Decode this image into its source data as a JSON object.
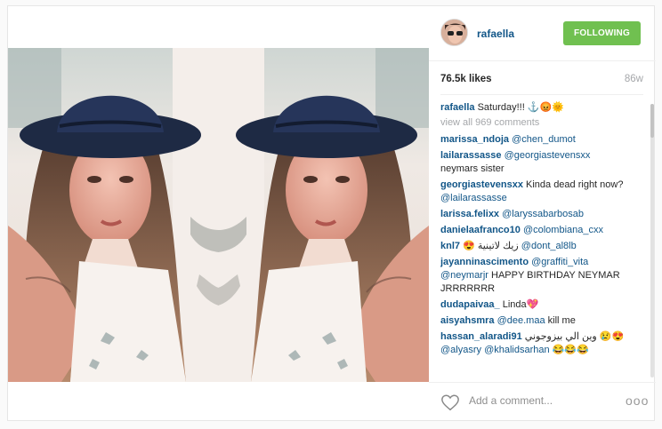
{
  "header": {
    "username": "rafaella",
    "follow_label": "FOLLOWING"
  },
  "stats": {
    "likes": "76.5k likes",
    "age": "86w"
  },
  "caption": {
    "user": "rafaella",
    "text": "Saturday!!! ⚓😡🌞"
  },
  "view_all": "view all 969 comments",
  "comments": [
    {
      "user": "marissa_ndoja",
      "mention": "@chen_dumot",
      "text": ""
    },
    {
      "user": "lailarassasse",
      "mention": "@georgiastevensxx",
      "text": "neymars sister"
    },
    {
      "user": "georgiastevensxx",
      "text": "Kinda dead right now?",
      "mention": "@lailarassasse"
    },
    {
      "user": "larissa.felixx",
      "mention": "@laryssabarbosab",
      "text": ""
    },
    {
      "user": "danielaafranco10",
      "mention": "@colombiana_cxx",
      "text": ""
    },
    {
      "user": "knl7",
      "text": "😍 زيك لاتينية",
      "mention": "@dont_al8lb"
    },
    {
      "user": "jayanninascimento",
      "mention": "@graffiti_vita",
      "mention2": "@neymarjr",
      "text": "HAPPY BIRTHDAY NEYMAR JRRRRRRR"
    },
    {
      "user": "dudapaivaa_",
      "text": "Linda💖"
    },
    {
      "user": "aisyahsmra",
      "mention": "@dee.maa",
      "text": "kill me"
    },
    {
      "user": "hassan_alaradi91",
      "text": "وين الي بيزوجوني 😢😍",
      "mention": "@alyasry",
      "mention2": "@khalidsarhan",
      "text2": "😂😂😂"
    }
  ],
  "footer": {
    "add_comment_placeholder": "Add a comment...",
    "more_label": "ooo"
  },
  "icons": [
    "heart-icon",
    "more-options-icon"
  ]
}
